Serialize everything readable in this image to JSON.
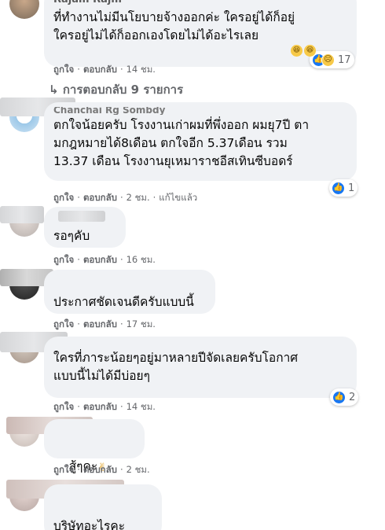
{
  "comments": [
    {
      "author": "Rajam Rajm",
      "text": "ที่ทำงานไม่มีนโยบายจ้างออกค่ะ ใครอยู่ได้ก็อยู่\nใครอยู่ไม่ได้ก็ออกเองโดยไม่ได้อะไรเลย",
      "like": "ถูกใจ",
      "reply": "ตอบกลับ",
      "time": "14 ชม.",
      "reaction_count": "17"
    },
    {
      "author": "Chanchai Rg Sombdy",
      "text": "ตกใจน้อยครับ โรงงานเก่าผมที่พึ่งออก ผมยุ7ปี ตา\nมกฎหมายได้8เดือน ตกใจอีก 5.37เดือน รวม\n13.37 เดือน โรงงานยุเหมาราชอีสเทินซีบอดร์",
      "like": "ถูกใจ",
      "reply": "ตอบกลับ",
      "time": "2 ชม.",
      "edited": "แก้ไขแล้ว",
      "reaction_count": "1"
    },
    {
      "author": "",
      "text": "รอๆคับ",
      "like": "ถูกใจ",
      "reply": "ตอบกลับ",
      "time": "16 ชม."
    },
    {
      "author": "",
      "text": "ประกาศชัดเจนดีครับแบบนี้",
      "like": "ถูกใจ",
      "reply": "ตอบกลับ",
      "time": "17 ชม."
    },
    {
      "author": "",
      "text": "ใครที่ภาระน้อยๆอยู่มาหลายปีจัดเลยครับโอกาศ\nแบบนี้ไม่ได้มีบ่อยๆ",
      "like": "ถูกใจ",
      "reply": "ตอบกลับ",
      "time": "14 ชม.",
      "reaction_count": "2"
    },
    {
      "author": "",
      "text": "สู้ๆคะ",
      "like": "ถูกใจ",
      "reply": "ตอบกลับ",
      "time": "2 ชม."
    },
    {
      "author": "",
      "text": "บริษัทอะไรคะ"
    }
  ],
  "replies_link": "การตอบกลับ 9 รายการ",
  "icons": {
    "reply_arrow": "reply-arrow-icon",
    "like": "like-reaction-icon",
    "haha": "haha-reaction-icon",
    "sad": "sad-reaction-icon"
  },
  "colors": {
    "bubble": "#f0f2f5",
    "meta": "#65676b",
    "like_blue": "#1877f2"
  }
}
